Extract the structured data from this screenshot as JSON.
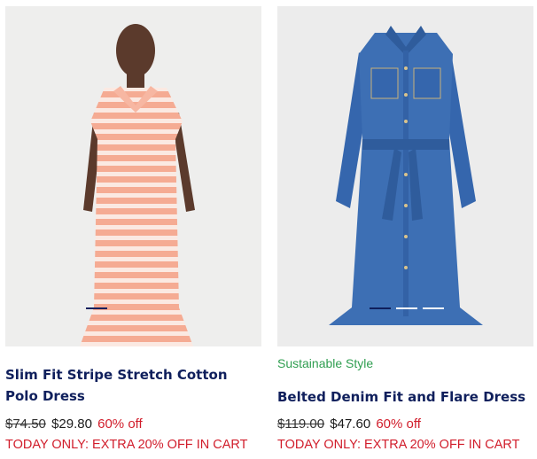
{
  "products": [
    {
      "title": "Slim Fit Stripe Stretch Cotton Polo Dress",
      "badge": "",
      "old_price": "$74.50",
      "price": "$29.80",
      "discount": "60% off",
      "promo": "TODAY ONLY: EXTRA 20% OFF IN CART",
      "image": "striped-polo-dress-photo",
      "carousel_dots": 1,
      "active_dot": 0
    },
    {
      "title": "Belted Denim Fit and Flare Dress",
      "badge": "Sustainable Style",
      "old_price": "$119.00",
      "price": "$47.60",
      "discount": "60% off",
      "promo": "TODAY ONLY: EXTRA 20% OFF IN CART",
      "image": "denim-shirt-dress-photo",
      "carousel_dots": 3,
      "active_dot": 0
    }
  ],
  "colors": {
    "title": "#0f1f5c",
    "discount": "#d11d2b",
    "badge": "#2f9e50"
  }
}
